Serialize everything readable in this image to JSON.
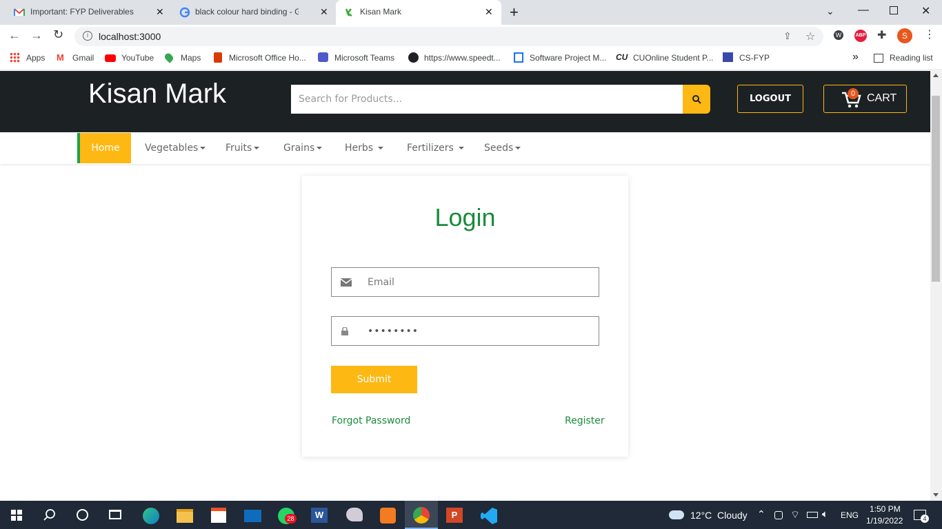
{
  "browser": {
    "tabs": [
      {
        "title": "Important: FYP Deliverables Subm",
        "icon": "gmail-icon"
      },
      {
        "title": "black colour hard binding - Goog",
        "icon": "google-icon"
      },
      {
        "title": "Kisan Mark",
        "icon": "kisan-mark-favicon",
        "active": true
      }
    ],
    "url": "localhost:3000",
    "bookmarks": [
      "Apps",
      "Gmail",
      "YouTube",
      "Maps",
      "Microsoft Office Ho...",
      "Microsoft Teams",
      "https://www.speedt...",
      "Software Project M...",
      "CUOnline Student P...",
      "CS-FYP"
    ],
    "reading_list": "Reading list",
    "more": "»",
    "profile_initial": "S",
    "abp": "ABP"
  },
  "site": {
    "brand": "Kisan Mark",
    "search_placeholder": "Search for Products...",
    "logout": "LOGOUT",
    "cart_label": "CART",
    "cart_count": "0",
    "nav": [
      "Home",
      "Vegetables",
      "Fruits",
      "Grains",
      "Herbs",
      "Fertilizers",
      "Seeds"
    ]
  },
  "login": {
    "title": "Login",
    "email_placeholder": "Email",
    "password_value": "••••••••",
    "submit": "Submit",
    "forgot": "Forgot Password",
    "register": "Register"
  },
  "taskbar": {
    "weather": "12°C  Cloudy",
    "lang": "ENG",
    "time": "1:50 PM",
    "date": "1/19/2022",
    "whatsapp_badge": "28",
    "notifications": "4"
  },
  "colors": {
    "accent": "#fdb813",
    "green": "#1a8a3c",
    "dark": "#1c2124"
  }
}
